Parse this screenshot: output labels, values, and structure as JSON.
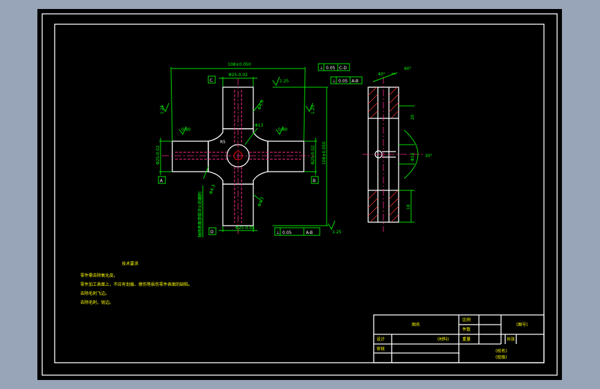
{
  "colors": {
    "background": "#000000",
    "outer_bg": "#98a4b7",
    "line": "#ffffff",
    "dimension": "#00e100",
    "centerline": "#ff2b8a",
    "note_text": "#ffff00"
  },
  "datum_labels": {
    "c": "C",
    "a": "A",
    "b": "B",
    "d": "D"
  },
  "dimensions": {
    "overall_top": "108±0.050",
    "arm_dia_top": "Φ25-0.02",
    "arm_dia_right": "Φ25-0.02",
    "arm_dia_bottom": "Φ25-0.02",
    "arm_dia_left": "Φ25-0.02",
    "overall_right": "108±0.050",
    "roughness_1": "1.25",
    "roughness_2": "1.25",
    "roughness_3": "1.25",
    "roughness_4": "0.80",
    "roughness_5": "0.80",
    "roughness_6": "1.25",
    "hole_1": "Φ4.3",
    "hole_2": "Φ4.3",
    "hole_3": "Φ4.3",
    "center_1": "Φ13",
    "center_2": "R5",
    "side_1": "40°",
    "side_2": "5",
    "side_3": "60°",
    "side_4": "20",
    "side_5": "18",
    "side_6": "Φ10",
    "side_7": "30°"
  },
  "tolerance_frames": [
    {
      "symbol": "⊥",
      "value": "0.05",
      "datum": "C-D"
    },
    {
      "symbol": "⊥",
      "value": "0.05",
      "datum": "A-B"
    },
    {
      "symbol": "⊥",
      "value": "0.05",
      "datum": "A-B"
    }
  ],
  "vertical_note": "轴颈表面渗碳淬火后磨削",
  "tech_requirements": {
    "title": "技术要求",
    "lines": [
      "零件需去除氧化皮。",
      "零件加工表面上，不应有划痕、擦伤等损伤零件表面的缺陷。",
      "去除毛刺飞边。",
      "去除毛刺，锐边。"
    ]
  },
  "title_block": {
    "name": "图名",
    "drawing_no": "(图号)",
    "label_scale": "比例",
    "label_qty": "件数",
    "label_design": "设计",
    "label_check": "审核",
    "material": "(材料)",
    "label_weight": "重量",
    "label_sheet": "共张",
    "school": "(校名)",
    "dept": "(班级)"
  }
}
